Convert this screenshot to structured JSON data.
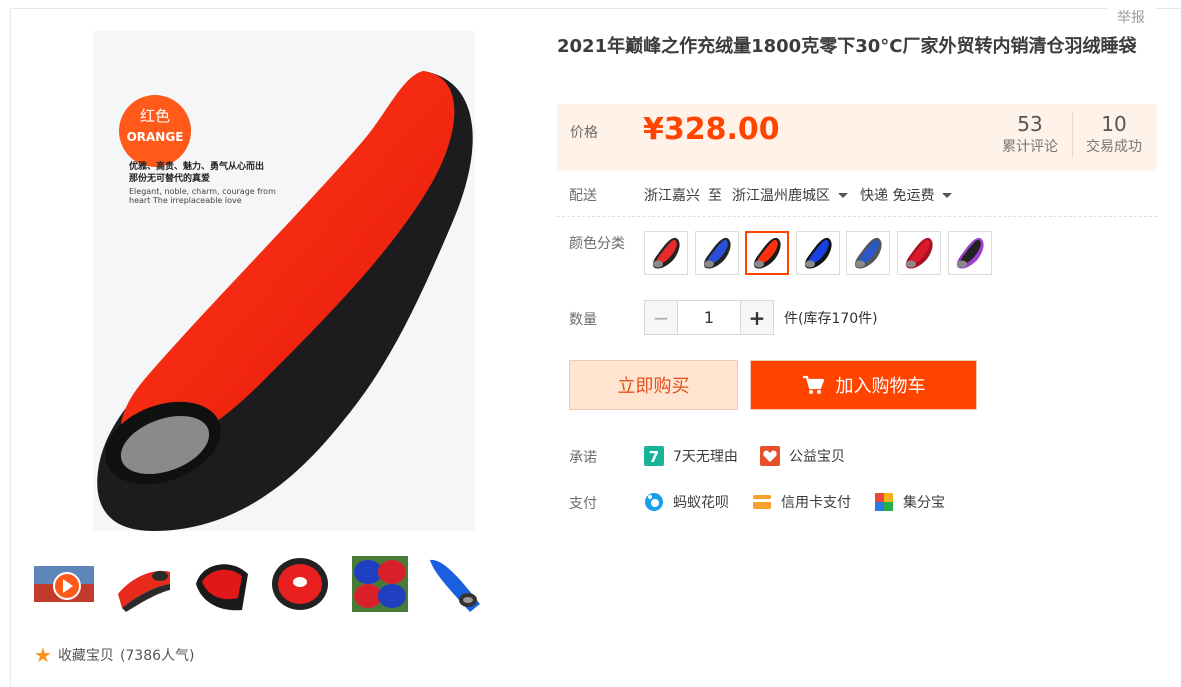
{
  "header": {
    "report_label": "举报"
  },
  "product": {
    "title": "2021年巅峰之作充绒量1800克零下30°C厂家外贸转内销清仓羽绒睡袋",
    "main_image": {
      "badge_cn": "红色",
      "badge_en": "ORANGE",
      "caption_cn_1": "优雅、高贵、魅力、勇气从心而出",
      "caption_cn_2": "那份无可替代的真爱",
      "caption_en_1": "Elegant, noble, charm, courage from",
      "caption_en_2": "heart The irreplaceable love"
    },
    "thumbnails": [
      {
        "name": "video-thumb",
        "colors": [
          "#3a6bb5",
          "#c23a2a"
        ]
      },
      {
        "name": "red-bag-side",
        "colors": [
          "#e82a1a",
          "#2a2a2a"
        ]
      },
      {
        "name": "red-bag-open",
        "colors": [
          "#e01818",
          "#1a1a1a"
        ]
      },
      {
        "name": "red-bag-hood",
        "colors": [
          "#e82020",
          "#222222"
        ]
      },
      {
        "name": "red-blue-bags",
        "colors": [
          "#1e3fbf",
          "#d8202a"
        ]
      },
      {
        "name": "blue-bag",
        "colors": [
          "#1a5fe0",
          "#333333"
        ]
      }
    ],
    "favorite": {
      "label": "收藏宝贝",
      "count_text": "(7386人气)"
    }
  },
  "price": {
    "label": "价格",
    "value": "¥328.00",
    "reviews": {
      "count": "53",
      "label": "累计评论"
    },
    "sales": {
      "count": "10",
      "label": "交易成功"
    }
  },
  "delivery": {
    "label": "配送",
    "from": "浙江嘉兴",
    "to_word": "至",
    "destination": "浙江温州鹿城区",
    "method": "快递 免运费"
  },
  "color": {
    "label": "颜色分类",
    "selected_index": 2,
    "options": [
      {
        "name": "red",
        "main": "#e82a2a",
        "accent": "#222222"
      },
      {
        "name": "blue",
        "main": "#2a4fd8",
        "accent": "#222222"
      },
      {
        "name": "orange-red",
        "main": "#ff3010",
        "accent": "#1a1a1a"
      },
      {
        "name": "royal-blue",
        "main": "#1a3fe0",
        "accent": "#111111"
      },
      {
        "name": "blue-gray",
        "main": "#2a58c8",
        "accent": "#555555"
      },
      {
        "name": "crimson",
        "main": "#d81a2a",
        "accent": "#aa1020"
      },
      {
        "name": "black-purple",
        "main": "#222222",
        "accent": "#a040d0"
      }
    ]
  },
  "quantity": {
    "label": "数量",
    "minus": "−",
    "value": "1",
    "plus": "+",
    "stock_text": "件(库存170件)"
  },
  "actions": {
    "buy_now": "立即购买",
    "add_to_cart": "加入购物车"
  },
  "promise": {
    "label": "承诺",
    "items": [
      {
        "icon": "seven-day-return-icon",
        "text": "7天无理由",
        "color": "#17b49a"
      },
      {
        "icon": "charity-icon",
        "text": "公益宝贝",
        "color": "#e8502a"
      }
    ]
  },
  "payment": {
    "label": "支付",
    "items": [
      {
        "icon": "huabei-icon",
        "text": "蚂蚁花呗",
        "color": "#1aa0e8"
      },
      {
        "icon": "credit-card-icon",
        "text": "信用卡支付",
        "color": "#f5a030"
      },
      {
        "icon": "jifenbao-icon",
        "text": "集分宝",
        "color": "#e84a3a"
      }
    ]
  },
  "colors": {
    "accent": "#ff4400",
    "price_bg": "#fff2e8",
    "buy_bg": "#ffe4d0"
  }
}
